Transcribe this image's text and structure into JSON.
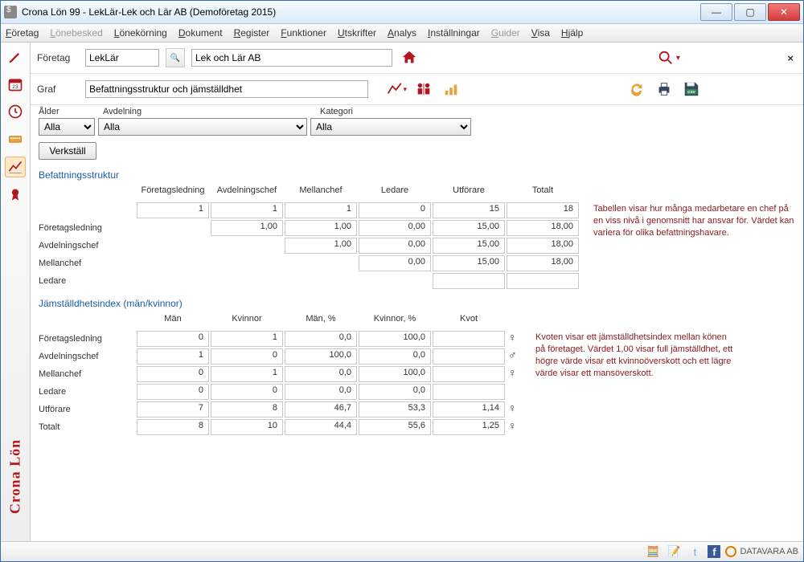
{
  "window": {
    "title": "Crona Lön 99 - LekLär-Lek och Lär AB (Demoföretag 2015)"
  },
  "menu": [
    "Företag",
    "Lönebesked",
    "Lönekörning",
    "Dokument",
    "Register",
    "Funktioner",
    "Utskrifter",
    "Analys",
    "Inställningar",
    "Guider",
    "Visa",
    "Hjälp"
  ],
  "menu_disabled": [
    1,
    9
  ],
  "toolbar1": {
    "label": "Företag",
    "code": "LekLär",
    "name": "Lek och Lär AB"
  },
  "toolbar2": {
    "label": "Graf",
    "value": "Befattningsstruktur och jämställdhet"
  },
  "filters": {
    "h1": "Ålder",
    "h2": "Avdelning",
    "h3": "Kategori",
    "v1": "Alla",
    "v2": "Alla",
    "v3": "Alla",
    "apply": "Verkställ"
  },
  "section1": {
    "title": "Befattningsstruktur",
    "headers": [
      "Företagsledning",
      "Avdelningschef",
      "Mellanchef",
      "Ledare",
      "Utförare",
      "Totalt"
    ],
    "count": [
      "1",
      "1",
      "1",
      "0",
      "15",
      "18"
    ],
    "rows": [
      {
        "label": "Företagsledning",
        "v": [
          "1,00",
          "1,00",
          "0,00",
          "15,00",
          "18,00"
        ],
        "offset": 1
      },
      {
        "label": "Avdelningschef",
        "v": [
          "1,00",
          "0,00",
          "15,00",
          "18,00"
        ],
        "offset": 2
      },
      {
        "label": "Mellanchef",
        "v": [
          "0,00",
          "15,00",
          "18,00"
        ],
        "offset": 3
      },
      {
        "label": "Ledare",
        "v": [
          "",
          ""
        ],
        "offset": 4
      }
    ],
    "info": "Tabellen visar hur många medarbetare en chef på en viss nivå i genomsnitt har ansvar för. Värdet kan variera för olika befattningshavare."
  },
  "section2": {
    "title": "Jämställdhetsindex (män/kvinnor)",
    "headers": [
      "Män",
      "Kvinnor",
      "Män, %",
      "Kvinnor, %",
      "Kvot"
    ],
    "rows": [
      {
        "label": "Företagsledning",
        "v": [
          "0",
          "1",
          "0,0",
          "100,0",
          ""
        ],
        "sym": "♀"
      },
      {
        "label": "Avdelningschef",
        "v": [
          "1",
          "0",
          "100,0",
          "0,0",
          ""
        ],
        "sym": "♂"
      },
      {
        "label": "Mellanchef",
        "v": [
          "0",
          "1",
          "0,0",
          "100,0",
          ""
        ],
        "sym": "♀"
      },
      {
        "label": "Ledare",
        "v": [
          "0",
          "0",
          "0,0",
          "0,0",
          ""
        ],
        "sym": ""
      },
      {
        "label": "Utförare",
        "v": [
          "7",
          "8",
          "46,7",
          "53,3",
          "1,14"
        ],
        "sym": "♀"
      },
      {
        "label": "Totalt",
        "v": [
          "8",
          "10",
          "44,4",
          "55,6",
          "1,25"
        ],
        "sym": "♀"
      }
    ],
    "info": "Kvoten visar ett jämställdhetsindex mellan könen på företaget. Värdet 1,00 visar full jämställdhet, ett högre värde visar ett kvinnoöverskott och ett lägre värde visar ett mansöverskott."
  },
  "brand": {
    "text": "Crona Lön",
    "footer": "DATAVARA AB"
  },
  "chart_data": {
    "type": "table",
    "title": "Jämställdhetsindex (män/kvinnor)",
    "rows": [
      {
        "role": "Företagsledning",
        "men": 0,
        "women": 1,
        "men_pct": 0.0,
        "women_pct": 100.0,
        "ratio": null
      },
      {
        "role": "Avdelningschef",
        "men": 1,
        "women": 0,
        "men_pct": 100.0,
        "women_pct": 0.0,
        "ratio": null
      },
      {
        "role": "Mellanchef",
        "men": 0,
        "women": 1,
        "men_pct": 0.0,
        "women_pct": 100.0,
        "ratio": null
      },
      {
        "role": "Ledare",
        "men": 0,
        "women": 0,
        "men_pct": 0.0,
        "women_pct": 0.0,
        "ratio": null
      },
      {
        "role": "Utförare",
        "men": 7,
        "women": 8,
        "men_pct": 46.7,
        "women_pct": 53.3,
        "ratio": 1.14
      },
      {
        "role": "Totalt",
        "men": 8,
        "women": 10,
        "men_pct": 44.4,
        "women_pct": 55.6,
        "ratio": 1.25
      }
    ]
  }
}
